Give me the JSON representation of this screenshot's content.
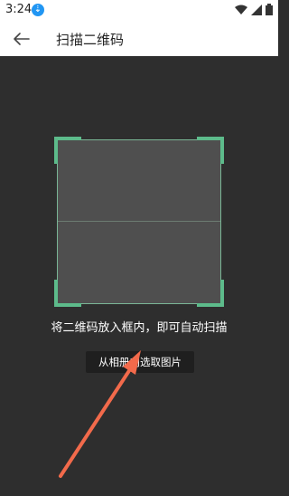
{
  "status_bar": {
    "time": "3:24",
    "download_badge_icon": "download-icon",
    "signal_icons": [
      "wifi-icon",
      "cell-signal-icon",
      "battery-icon"
    ]
  },
  "app_bar": {
    "back_icon": "arrow-left-icon",
    "title": "扫描二维码"
  },
  "scanner": {
    "hint": "将二维码放入框内，即可自动扫描",
    "album_button": "从相册内选取图片"
  },
  "colors": {
    "corner": "#5dbb8b",
    "background": "#2e2e2e",
    "frame": "#4f4f4f",
    "annotation_arrow": "#f26a4b"
  }
}
